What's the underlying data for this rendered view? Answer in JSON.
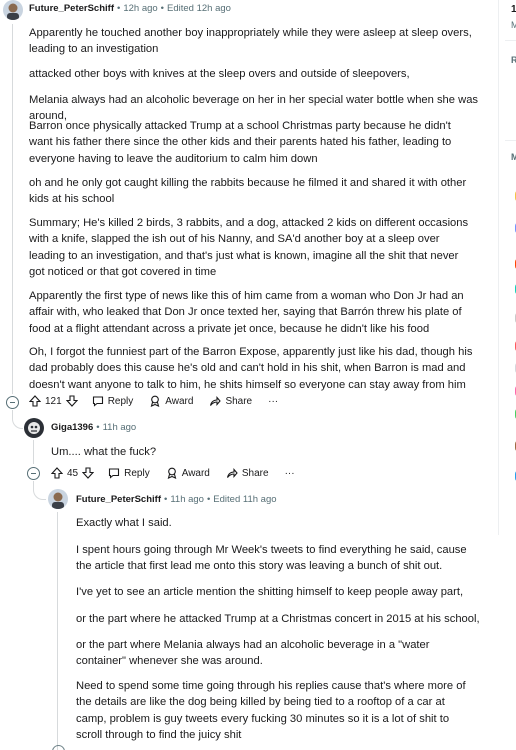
{
  "comments": [
    {
      "user": "Future_PeterSchiff",
      "time": "12h ago",
      "edited": "Edited 12h ago",
      "paragraphs": [
        "Apparently he touched another boy inappropriately while they were asleep at sleep overs, leading to an investigation",
        "attacked other boys with knives at the sleep overs and outside of sleepovers,",
        "Melania always had an alcoholic beverage on her in her special water bottle when she was around,",
        "Barron once physically attacked Trump at a school Christmas party because he didn't want his father there since the other kids and their parents hated his father, leading to everyone having to leave the auditorium to calm him down",
        "oh and he only got caught killing the rabbits because he filmed it and shared it with other kids at his school",
        "Summary; He's killed 2 birds, 3 rabbits, and a dog, attacked 2 kids on different occasions with a knife, slapped the ish out of his Nanny, and SA'd another boy at a sleep over leading to an investigation, and that's just what is known, imagine all the shit that never got noticed or that got covered in time",
        "Apparently the first type of news like this of him came from a woman who Don Jr had an affair with, who leaked that Don Jr once texted her, saying that Barrón threw his plate of food at a flight attendant across a private jet once, because he didn't like his food",
        "Oh, I forgot the funniest part of the Barron Expose, apparently just like his dad, though his dad probably does this cause he's old and can't hold in his shit, when Barron is mad and doesn't want anyone to talk to him, he shits himself so everyone can stay away from him"
      ],
      "votes": "121",
      "reply": "Reply",
      "award": "Award",
      "share": "Share",
      "more": "···"
    },
    {
      "user": "Giga1396",
      "time": "11h ago",
      "paragraphs": [
        "Um.... what the fuck?"
      ],
      "votes": "45",
      "reply": "Reply",
      "award": "Award",
      "share": "Share",
      "more": "···"
    },
    {
      "user": "Future_PeterSchiff",
      "time": "11h ago",
      "edited": "Edited 11h ago",
      "paragraphs": [
        "Exactly what I said.",
        "I spent hours going through Mr Week's tweets to find everything he said, cause the article that first lead me onto this story was leaving a bunch of shit out.",
        "I've yet to see an article mention the shitting himself to keep people away part,",
        "or the part where he attacked Trump at a Christmas concert in 2015 at his school,",
        "or the part where Melania always had an alcoholic beverage in a \"water container\" whenever she was around.",
        "Need to spend some time going through his replies cause that's where more of the details are like the dog being killed by being tied to a rooftop of a car at camp, problem is guy tweets every fucking 30 minutes so it is a lot of shit to scroll through to find the juicy shit"
      ]
    }
  ],
  "sidebar": {
    "title_fragment": "1",
    "line2": "M",
    "line3": "RU",
    "line4": "M",
    "colors": [
      "#f6c544",
      "#7193ff",
      "#ff4500",
      "#0dd3bb",
      "#c9c9c9",
      "#ff585b",
      "#d4d7dc",
      "#ff66ac",
      "#46d160",
      "#a06a42",
      "#24a0ed"
    ]
  }
}
